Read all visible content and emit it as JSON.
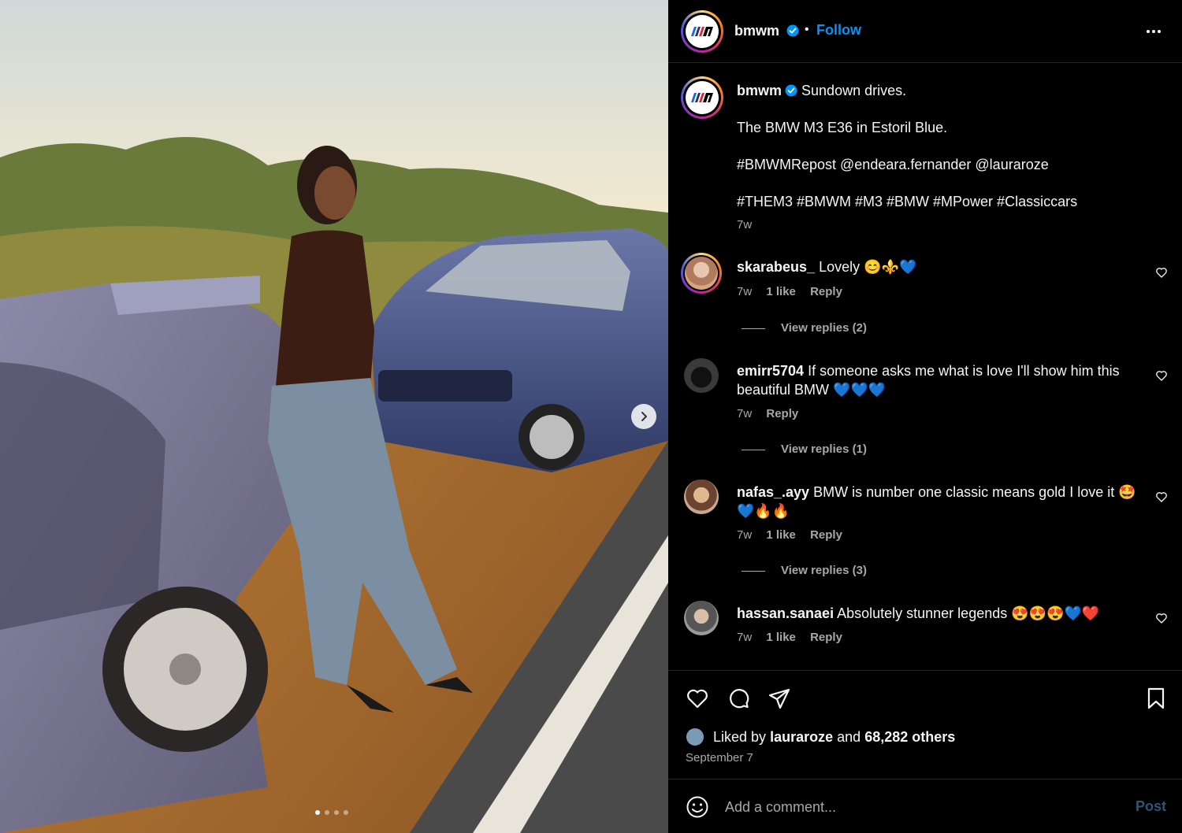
{
  "post": {
    "username": "bmwm",
    "separator": "•",
    "follow_label": "Follow",
    "caption_lines": [
      "Sundown drives.",
      "The BMW M3 E36 in Estoril Blue.",
      "#BMWMRepost @endeara.fernander @lauraroze",
      "#THEM3 #BMWM #M3 #BMW #MPower #Classiccars"
    ],
    "caption_time": "7w"
  },
  "comments": [
    {
      "username": "skarabeus_",
      "text": "Lovely 😊⚜️💙",
      "time": "7w",
      "likes": "1 like",
      "reply": "Reply",
      "view_replies": "View replies (2)"
    },
    {
      "username": "emirr5704",
      "text": "If someone asks me what is love I'll show him this beautiful BMW 💙💙💙",
      "time": "7w",
      "likes": "",
      "reply": "Reply",
      "view_replies": "View replies (1)"
    },
    {
      "username": "nafas_.ayy",
      "text": "BMW is number one classic means gold I love it 🤩💙🔥🔥",
      "time": "7w",
      "likes": "1 like",
      "reply": "Reply",
      "view_replies": "View replies (3)"
    },
    {
      "username": "hassan.sanaei",
      "text": "Absolutely stunner legends 😍😍😍💙❤️",
      "time": "7w",
      "likes": "1 like",
      "reply": "Reply",
      "view_replies": ""
    }
  ],
  "likes": {
    "prefix": "Liked by",
    "user": "lauraroze",
    "middle": "and",
    "count": "68,282 others"
  },
  "date": "September 7",
  "comment_box": {
    "placeholder": "Add a comment...",
    "post_label": "Post"
  },
  "carousel": {
    "total": 4,
    "current": 1
  },
  "icons": {
    "more": "more-options-icon",
    "heart": "heart-icon",
    "comment": "comment-icon",
    "share": "share-icon",
    "save": "bookmark-icon",
    "emoji": "emoji-icon",
    "next": "chevron-right-icon",
    "verified": "verified-badge-icon"
  },
  "colors": {
    "accent": "#0095f6",
    "background": "#000000",
    "muted": "#a8a8a8",
    "post_disabled": "#2f5476"
  }
}
